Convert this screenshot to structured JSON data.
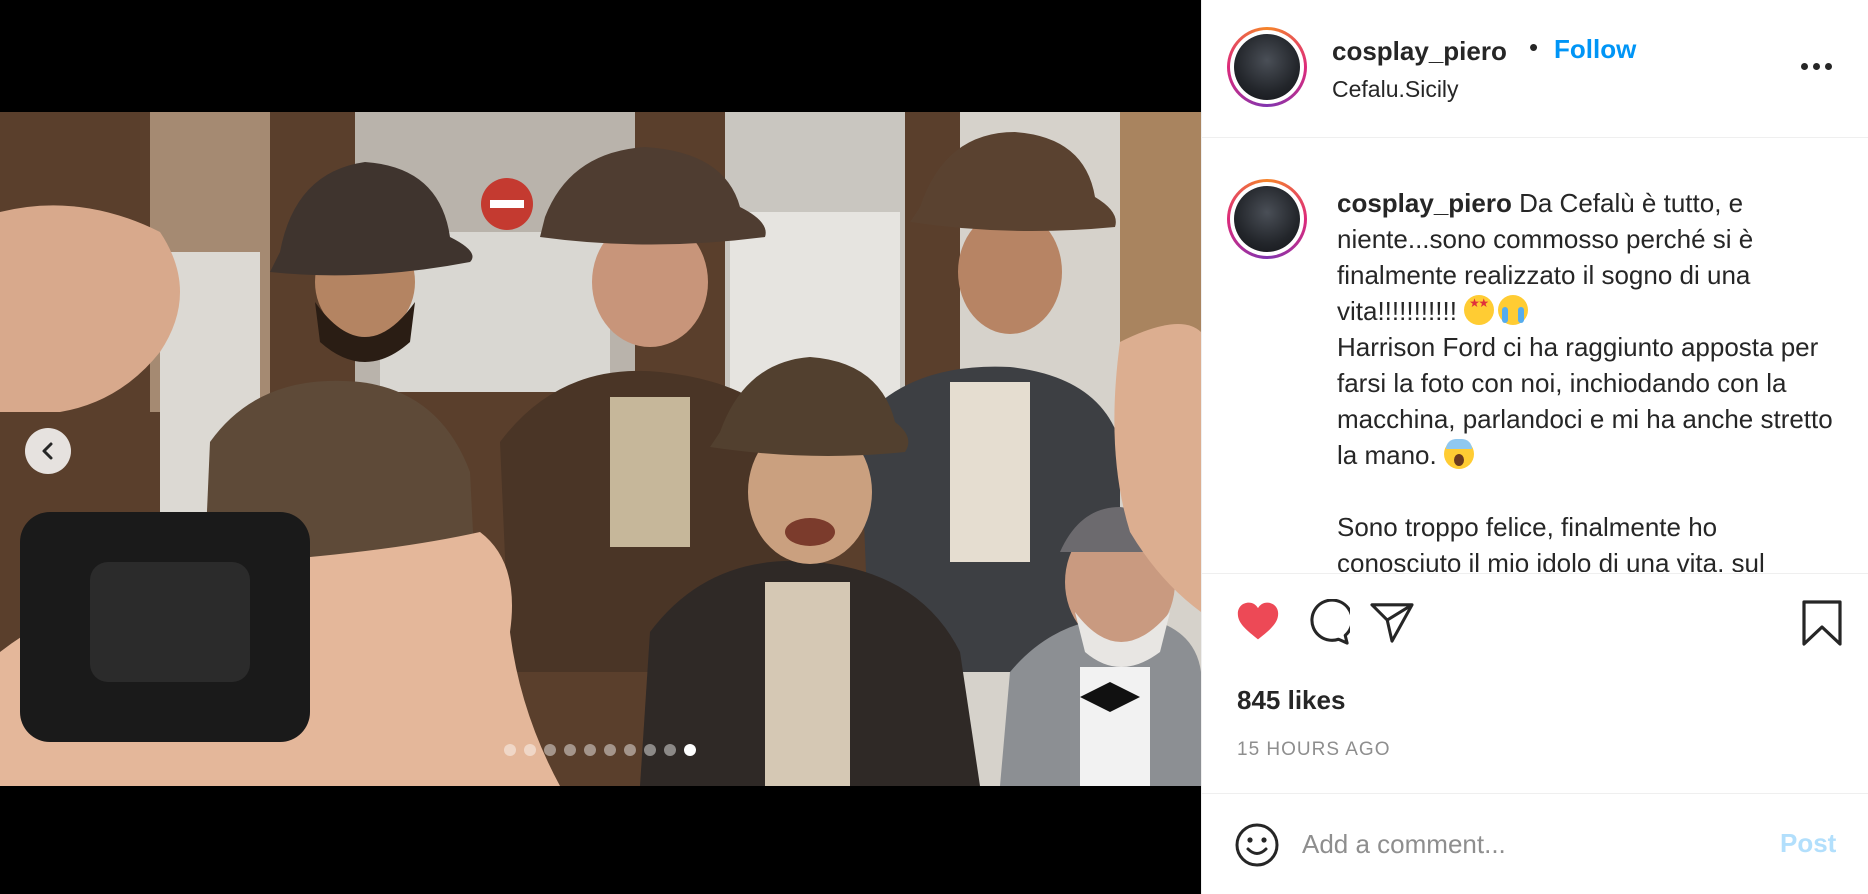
{
  "post": {
    "username": "cosplay_piero",
    "separator": "•",
    "follow_label": "Follow",
    "location": "Cefalu.Sicily",
    "more_icon": "more-horizontal-icon"
  },
  "media": {
    "slide_count": 10,
    "active_slide_index": 9,
    "prev_icon": "chevron-left-icon"
  },
  "caption": {
    "username": "cosplay_piero",
    "line1": " Da Cefalù è tutto, e niente...sono commosso perché si è finalmente realizzato il sogno di una vita!!!!!!!!!!!",
    "line2": "Harrison Ford ci ha raggiunto apposta per farsi la foto con noi, inchiodando con la macchina, parlandoci e mi ha anche stretto la mano.",
    "line3": "Sono troppo felice, finalmente ho conosciuto il mio idolo di una vita, sul"
  },
  "actions": {
    "like_icon": "heart-filled-icon",
    "comment_icon": "comment-icon",
    "share_icon": "paper-plane-icon",
    "save_icon": "bookmark-icon",
    "liked_color": "#ed4956",
    "likes_text": "845 likes",
    "time_ago": "15 HOURS AGO"
  },
  "comment": {
    "emoji_icon": "smiley-icon",
    "placeholder": "Add a comment...",
    "post_label": "Post",
    "post_color_disabled": "#b2dffc"
  },
  "colors": {
    "link_blue": "#0095f6",
    "text_primary": "#262626",
    "text_secondary": "#8e8e8e",
    "border": "#efefef"
  }
}
